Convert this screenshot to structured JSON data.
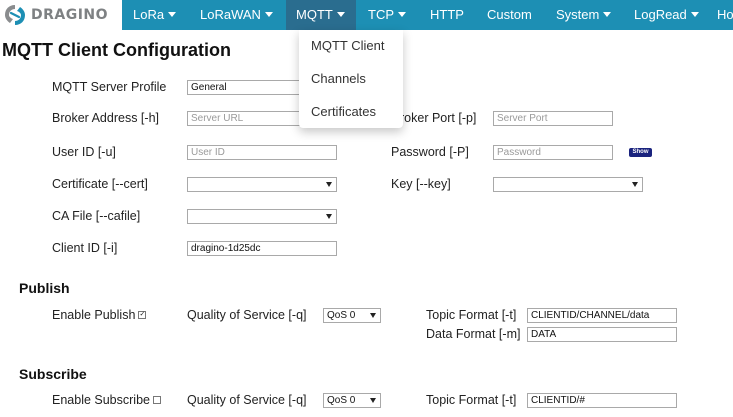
{
  "brand": {
    "name": "DRAGINO"
  },
  "nav": {
    "items": [
      {
        "label": "LoRa",
        "caret": true
      },
      {
        "label": "LoRaWAN",
        "caret": true
      },
      {
        "label": "MQTT",
        "caret": true,
        "active": true
      },
      {
        "label": "TCP",
        "caret": true
      },
      {
        "label": "HTTP",
        "caret": false
      },
      {
        "label": "Custom",
        "caret": false
      },
      {
        "label": "System",
        "caret": true
      },
      {
        "label": "LogRead",
        "caret": true
      },
      {
        "label": "Ho",
        "caret": false
      }
    ]
  },
  "dropdown": {
    "items": [
      "MQTT Client",
      "Channels",
      "Certificates"
    ]
  },
  "page": {
    "title": "MQTT Client Configuration"
  },
  "form": {
    "server_profile": {
      "label": "MQTT Server Profile",
      "value": "General"
    },
    "broker_address": {
      "label": "Broker Address [-h]",
      "placeholder": "Server URL"
    },
    "broker_port": {
      "label": "roker Port [-p]",
      "placeholder": "Server Port"
    },
    "user_id": {
      "label": "User ID [-u]",
      "placeholder": "User ID"
    },
    "password": {
      "label": "Password [-P]",
      "placeholder": "Password",
      "show_label": "Show"
    },
    "certificate": {
      "label": "Certificate [--cert]",
      "value": ""
    },
    "key": {
      "label": "Key [--key]",
      "value": ""
    },
    "ca_file": {
      "label": "CA File [--cafile]",
      "value": ""
    },
    "client_id": {
      "label": "Client ID [-i]",
      "value": "dragino-1d25dc"
    }
  },
  "publish": {
    "title": "Publish",
    "enable_label": "Enable Publish",
    "enabled": true,
    "qos_label": "Quality of Service [-q]",
    "qos_value": "QoS 0",
    "topic_label": "Topic Format [-t]",
    "topic_value": "CLIENTID/CHANNEL/data",
    "data_label": "Data Format [-m]",
    "data_value": "DATA"
  },
  "subscribe": {
    "title": "Subscribe",
    "enable_label": "Enable Subscribe",
    "enabled": false,
    "qos_label": "Quality of Service [-q]",
    "qos_value": "QoS 0",
    "topic_label": "Topic Format [-t]",
    "topic_value": "CLIENTID/#"
  },
  "colors": {
    "navbar": "#1d8fb4",
    "nav_active": "#2a6d8f",
    "show_button": "#1a237e",
    "logo_blue": "#1d8fb4",
    "logo_gray": "#8a8c8e"
  }
}
